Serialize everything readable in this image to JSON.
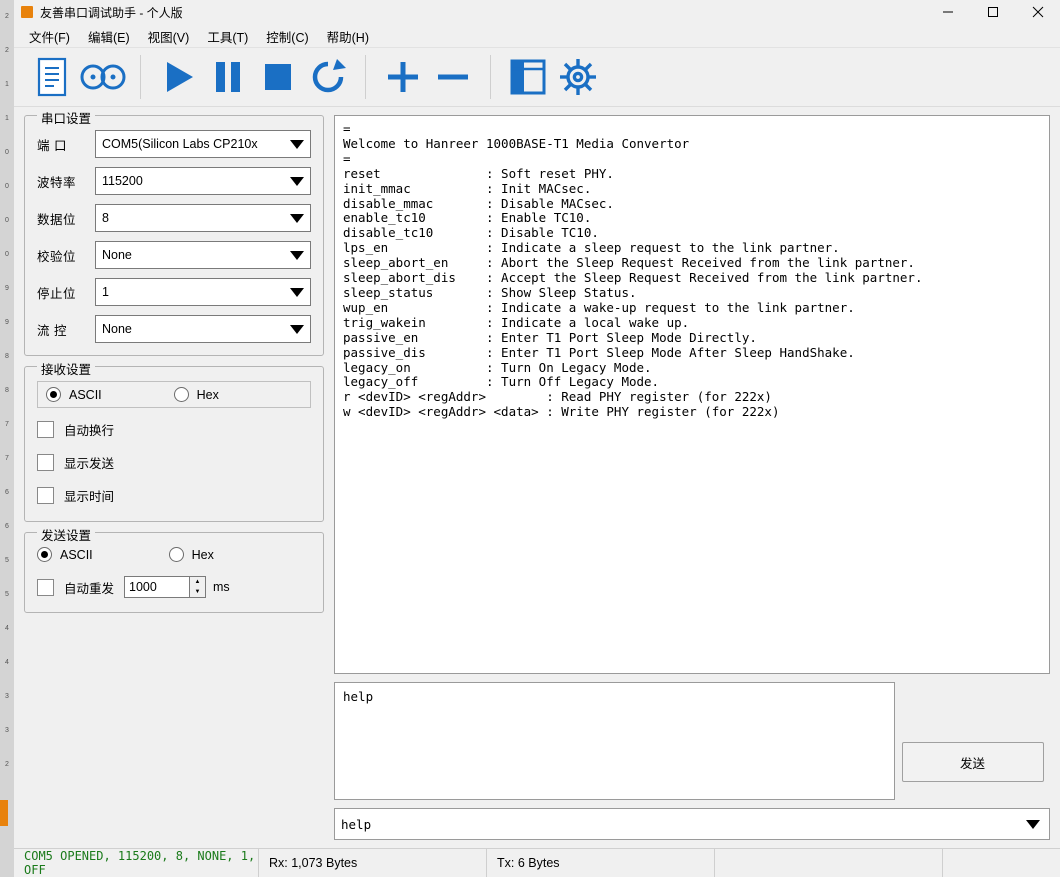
{
  "edge": {
    "labels": [
      "2",
      "2",
      "1",
      "1",
      "0",
      "0",
      "0",
      "0",
      "9",
      "9",
      "8",
      "8",
      "7",
      "7",
      "6",
      "6",
      "5",
      "5",
      "4",
      "4",
      "3",
      "3",
      "2"
    ]
  },
  "window": {
    "title": "友善串口调试助手 - 个人版",
    "icon": "app-icon",
    "minimize": "—",
    "maximize": "☐",
    "close": "✕"
  },
  "menu": [
    {
      "label": "文件(F)",
      "name": "menu-file"
    },
    {
      "label": "编辑(E)",
      "name": "menu-edit"
    },
    {
      "label": "视图(V)",
      "name": "menu-view"
    },
    {
      "label": "工具(T)",
      "name": "menu-tools"
    },
    {
      "label": "控制(C)",
      "name": "menu-control"
    },
    {
      "label": "帮助(H)",
      "name": "menu-help"
    }
  ],
  "toolbar": {
    "buttons": [
      {
        "name": "new-document-button",
        "icon": "document-icon"
      },
      {
        "name": "connect-button",
        "icon": "serial-port-icon"
      },
      {
        "name": "start-button",
        "icon": "play-icon"
      },
      {
        "name": "pause-button",
        "icon": "pause-icon"
      },
      {
        "name": "stop-button",
        "icon": "stop-icon"
      },
      {
        "name": "refresh-button",
        "icon": "refresh-icon"
      },
      {
        "name": "add-button",
        "icon": "plus-icon"
      },
      {
        "name": "remove-button",
        "icon": "minus-icon"
      },
      {
        "name": "layout-button",
        "icon": "window-layout-icon"
      },
      {
        "name": "settings-button",
        "icon": "gear-icon"
      }
    ]
  },
  "serial_settings": {
    "legend": "串口设置",
    "fields": [
      {
        "label": "端  口",
        "value": "COM5(Silicon Labs CP210x",
        "name": "port"
      },
      {
        "label": "波特率",
        "value": "115200",
        "name": "baudrate"
      },
      {
        "label": "数据位",
        "value": "8",
        "name": "databits"
      },
      {
        "label": "校验位",
        "value": "None",
        "name": "parity"
      },
      {
        "label": "停止位",
        "value": "1",
        "name": "stopbits"
      },
      {
        "label": "流  控",
        "value": "None",
        "name": "flowcontrol"
      }
    ]
  },
  "receive_settings": {
    "legend": "接收设置",
    "mode_ascii": "ASCII",
    "mode_hex": "Hex",
    "mode_selected": "ASCII",
    "checks": [
      {
        "label": "自动换行",
        "checked": false,
        "name": "auto-wrap"
      },
      {
        "label": "显示发送",
        "checked": false,
        "name": "show-send"
      },
      {
        "label": "显示时间",
        "checked": false,
        "name": "show-time"
      }
    ]
  },
  "send_settings": {
    "legend": "发送设置",
    "mode_ascii": "ASCII",
    "mode_hex": "Hex",
    "mode_selected": "ASCII",
    "auto_repeat_label": "自动重发",
    "auto_repeat_checked": false,
    "interval_value": "1000",
    "interval_unit": "ms"
  },
  "terminal": {
    "text": "=\nWelcome to Hanreer 1000BASE-T1 Media Convertor\n=\nreset              : Soft reset PHY.\ninit_mmac          : Init MACsec.\ndisable_mmac       : Disable MACsec.\nenable_tc10        : Enable TC10.\ndisable_tc10       : Disable TC10.\nlps_en             : Indicate a sleep request to the link partner.\nsleep_abort_en     : Abort the Sleep Request Received from the link partner.\nsleep_abort_dis    : Accept the Sleep Request Received from the link partner.\nsleep_status       : Show Sleep Status.\nwup_en             : Indicate a wake-up request to the link partner.\ntrig_wakein        : Indicate a local wake up.\npassive_en         : Enter T1 Port Sleep Mode Directly.\npassive_dis        : Enter T1 Port Sleep Mode After Sleep HandShake.\nlegacy_on          : Turn On Legacy Mode.\nlegacy_off         : Turn Off Legacy Mode.\nr <devID> <regAddr>        : Read PHY register (for 222x)\nw <devID> <regAddr> <data> : Write PHY register (for 222x)"
  },
  "send_panel": {
    "text": "help",
    "button_label": "发送"
  },
  "command_bar": {
    "value": "help"
  },
  "statusbar": {
    "connection": "COM5 OPENED, 115200, 8, NONE, 1, OFF",
    "rx": "Rx: 1,073 Bytes",
    "tx": "Tx: 6 Bytes",
    "blank1": "",
    "blank2": ""
  },
  "colors": {
    "accent": "#1a6fc4",
    "status_green": "#1a7a1a",
    "app_orange": "#e8820c"
  }
}
